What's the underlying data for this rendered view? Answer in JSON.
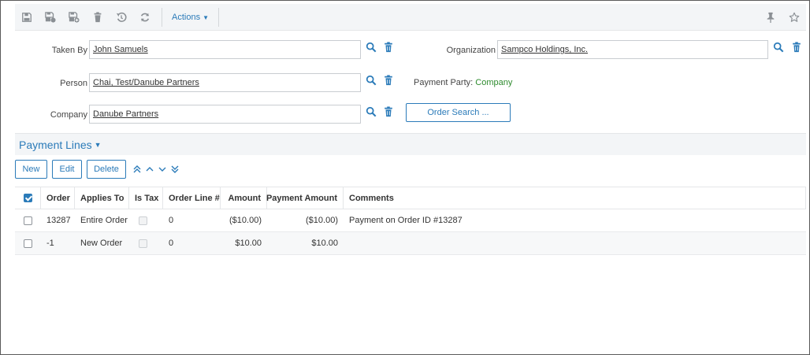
{
  "toolbar": {
    "actions_label": "Actions",
    "icons": [
      "save-icon",
      "save-and-close-icon",
      "save-and-new-icon",
      "delete-icon",
      "undo-icon",
      "refresh-icon",
      "pin-icon",
      "star-icon"
    ]
  },
  "form": {
    "taken_by": {
      "label": "Taken By",
      "value": "John Samuels"
    },
    "person": {
      "label": "Person",
      "value": "Chai, Test/Danube Partners"
    },
    "company": {
      "label": "Company",
      "value": "Danube Partners"
    },
    "organization": {
      "label": "Organization",
      "value": "Sampco Holdings, Inc."
    },
    "payment_party": {
      "label": "Payment Party:",
      "value": "Company"
    },
    "order_search_label": "Order Search ..."
  },
  "section": {
    "title": "Payment Lines"
  },
  "buttons": {
    "new": "New",
    "edit": "Edit",
    "delete": "Delete"
  },
  "table": {
    "columns": {
      "order": "Order",
      "applies_to": "Applies To",
      "is_tax": "Is Tax",
      "order_line": "Order Line #",
      "amount": "Amount",
      "payment_amount": "Payment Amount",
      "comments": "Comments"
    },
    "rows": [
      {
        "order": "13287",
        "applies_to": "Entire Order",
        "order_line": "0",
        "amount": "($10.00)",
        "payment_amount": "($10.00)",
        "comments": "Payment on Order ID #13287"
      },
      {
        "order": "-1",
        "applies_to": "New Order",
        "order_line": "0",
        "amount": "$10.00",
        "payment_amount": "$10.00",
        "comments": ""
      }
    ]
  },
  "colors": {
    "accent": "#2b7bb9",
    "positive": "#2e8b2e"
  }
}
